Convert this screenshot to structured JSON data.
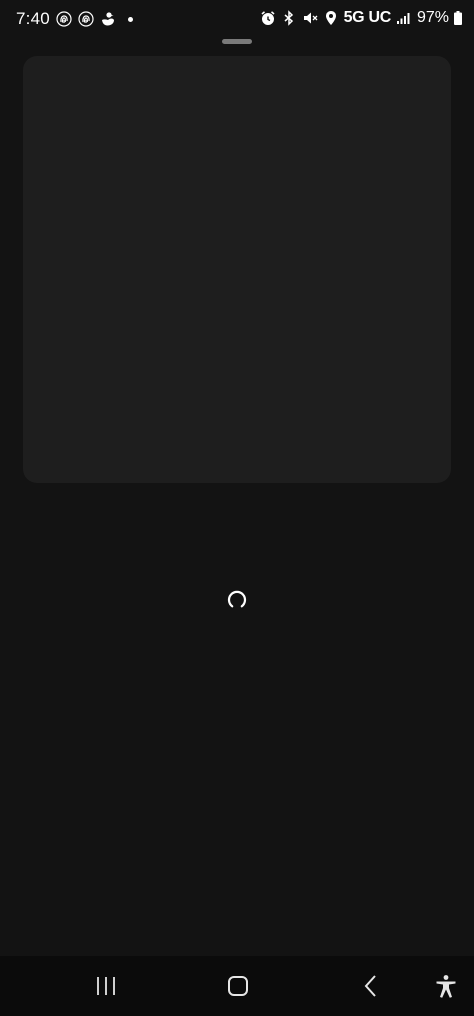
{
  "status_bar": {
    "time": "7:40",
    "left_icons": [
      "fingerprint-icon",
      "fingerprint-icon",
      "duck-icon"
    ],
    "right_icons": [
      "alarm-icon",
      "bluetooth-icon",
      "mute-icon",
      "location-icon"
    ],
    "network": "5G UC",
    "battery": "97%"
  },
  "nav_bar": {
    "buttons": [
      "recent-apps-icon",
      "home-icon",
      "back-icon",
      "accessibility-icon"
    ]
  }
}
